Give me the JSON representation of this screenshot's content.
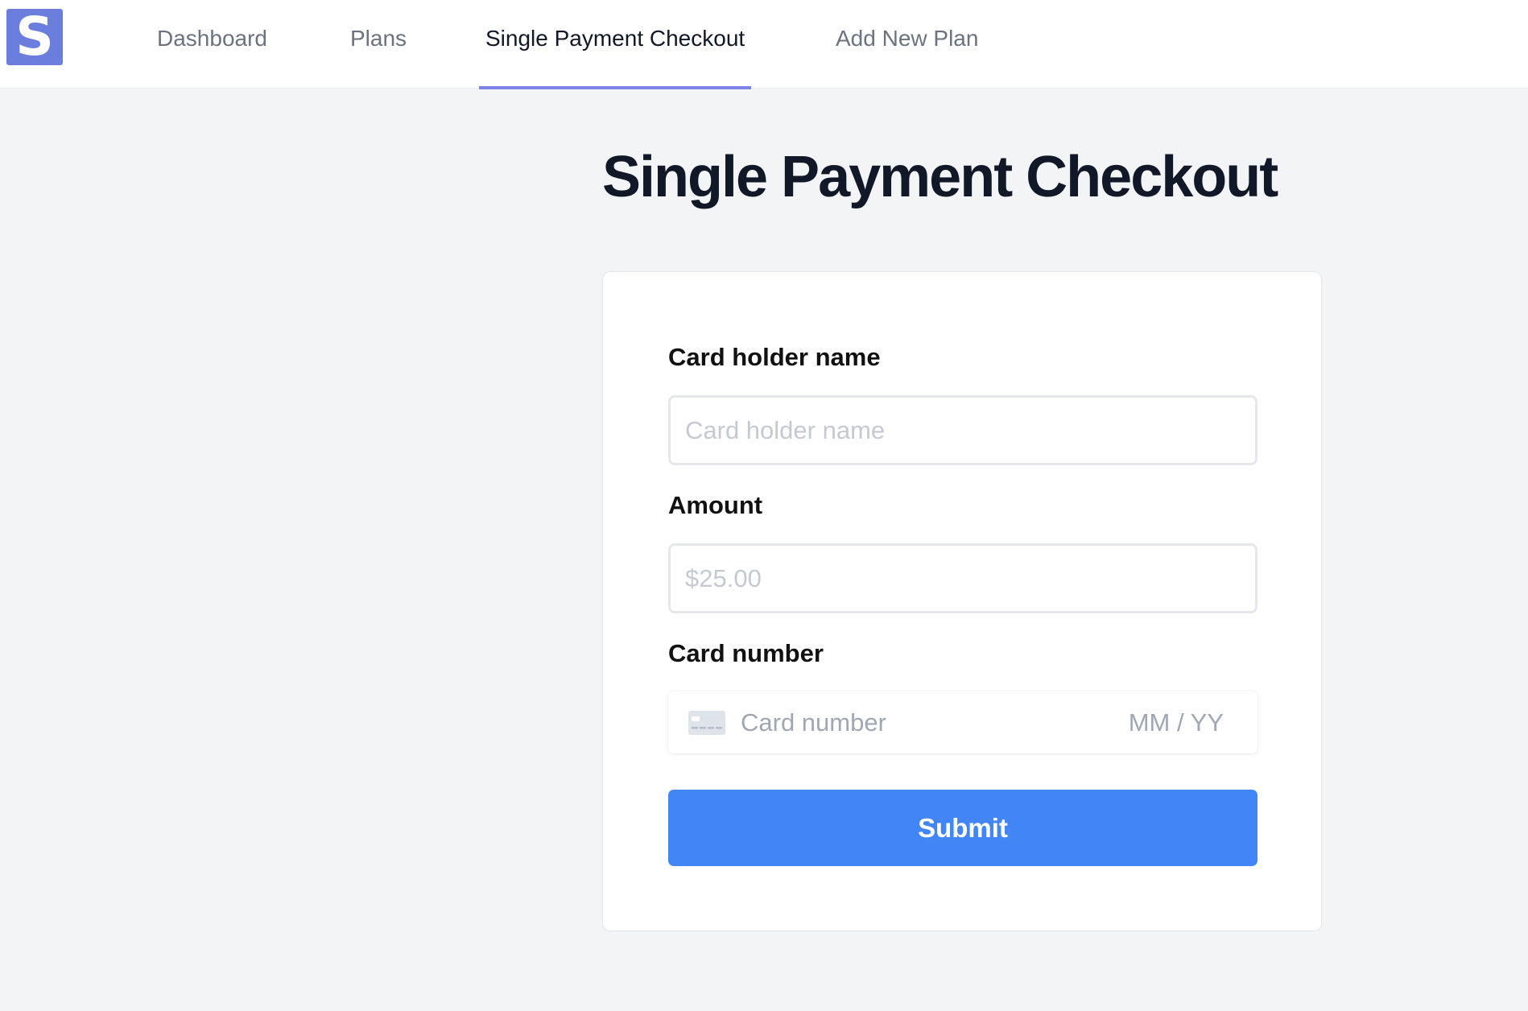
{
  "brand": {
    "logo_letter": "S",
    "accent_color": "#6b7ddd"
  },
  "nav": {
    "items": [
      {
        "label": "Dashboard",
        "active": false
      },
      {
        "label": "Plans",
        "active": false
      },
      {
        "label": "Single Payment Checkout",
        "active": true
      },
      {
        "label": "Add New Plan",
        "active": false
      }
    ],
    "active_underline_color": "#7b83e5"
  },
  "page": {
    "title": "Single Payment Checkout"
  },
  "form": {
    "name_label": "Card holder name",
    "name_placeholder": "Card holder name",
    "name_value": "",
    "amount_label": "Amount",
    "amount_placeholder": "$25.00",
    "amount_value": "",
    "card_label": "Card number",
    "card_icon": "credit-card-icon",
    "card_number_placeholder": "Card number",
    "card_expiry_placeholder": "MM / YY",
    "submit_label": "Submit",
    "submit_color": "#4285f4"
  }
}
